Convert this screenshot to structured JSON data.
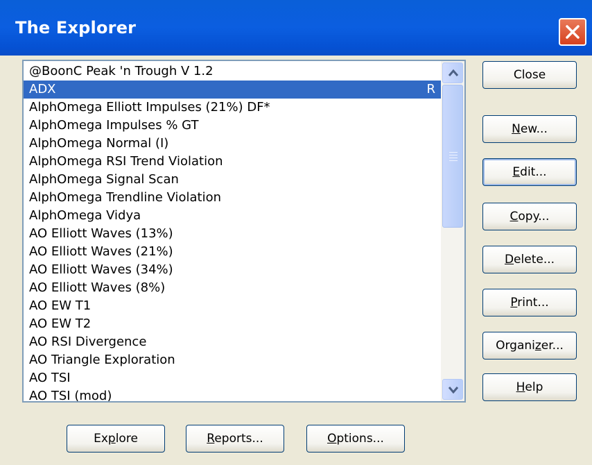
{
  "window": {
    "title": "The Explorer"
  },
  "list": {
    "items": [
      {
        "label": "@BoonC Peak 'n Trough V 1.2",
        "flag": ""
      },
      {
        "label": "ADX",
        "flag": "R",
        "selected": true
      },
      {
        "label": "AlphOmega Elliott Impulses (21%) DF*",
        "flag": ""
      },
      {
        "label": "AlphOmega Impulses % GT",
        "flag": ""
      },
      {
        "label": "AlphOmega Normal (I)",
        "flag": ""
      },
      {
        "label": "AlphOmega RSI Trend Violation",
        "flag": ""
      },
      {
        "label": "AlphOmega Signal Scan",
        "flag": ""
      },
      {
        "label": "AlphOmega Trendline Violation",
        "flag": ""
      },
      {
        "label": "AlphOmega Vidya",
        "flag": ""
      },
      {
        "label": "AO Elliott Waves (13%)",
        "flag": ""
      },
      {
        "label": "AO Elliott Waves (21%)",
        "flag": ""
      },
      {
        "label": "AO Elliott Waves (34%)",
        "flag": ""
      },
      {
        "label": "AO Elliott Waves (8%)",
        "flag": ""
      },
      {
        "label": "AO EW T1",
        "flag": ""
      },
      {
        "label": "AO EW T2",
        "flag": ""
      },
      {
        "label": "AO RSI Divergence",
        "flag": ""
      },
      {
        "label": "AO Triangle Exploration",
        "flag": ""
      },
      {
        "label": "AO TSI",
        "flag": ""
      },
      {
        "label": "AO TSI (mod)",
        "flag": ""
      }
    ]
  },
  "buttons": {
    "close": "Close",
    "new": {
      "k": "N",
      "r": "ew..."
    },
    "edit": {
      "k": "E",
      "r": "dit..."
    },
    "copy": {
      "k": "C",
      "r": "opy..."
    },
    "delete": {
      "k": "D",
      "r": "elete..."
    },
    "print": {
      "k": "P",
      "r": "rint..."
    },
    "organizer": {
      "a": "Organi",
      "k": "z",
      "r": "er..."
    },
    "help": {
      "k": "H",
      "r": "elp"
    },
    "explore": {
      "a": "Ex",
      "k": "p",
      "r": "lore"
    },
    "reports": {
      "k": "R",
      "r": "eports..."
    },
    "options": {
      "k": "O",
      "r": "ptions..."
    }
  },
  "colors": {
    "titlebar": "#0b5ee0",
    "selection": "#316ac5",
    "face": "#ece9d8",
    "close_button": "#d6411e"
  }
}
